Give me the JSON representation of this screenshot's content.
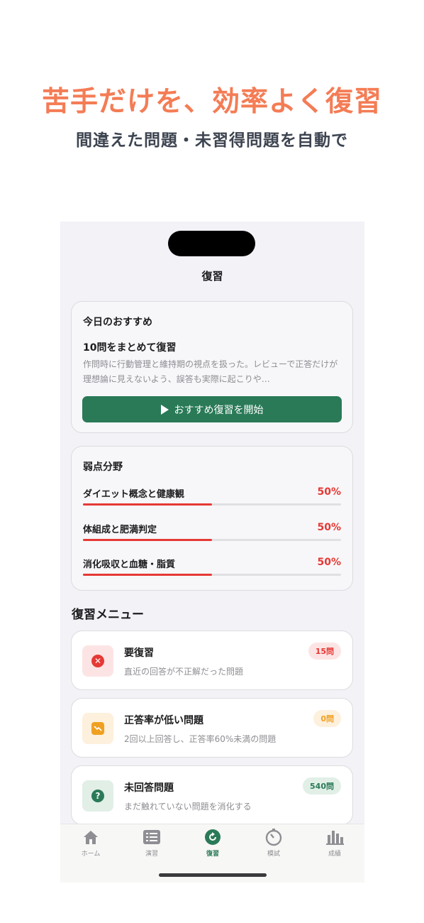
{
  "promo": {
    "headline": "苦手だけを、効率よく復習",
    "subheadline": "間違えた問題・未習得問題を自動で"
  },
  "nav": {
    "title": "復習"
  },
  "recommend": {
    "heading": "今日のおすすめ",
    "title": "10問をまとめて復習",
    "description": "作問時に行動管理と維持期の視点を扱った。レビューで正答だけが理想論に見えないよう、誤答も実際に起こりや…",
    "button_label": "おすすめ復習を開始"
  },
  "weak": {
    "heading": "弱点分野",
    "items": [
      {
        "label": "ダイエット概念と健康観",
        "percent_label": "50%",
        "rate": 0.5
      },
      {
        "label": "体組成と肥満判定",
        "percent_label": "50%",
        "rate": 0.5
      },
      {
        "label": "消化吸収と血糖・脂質",
        "percent_label": "50%",
        "rate": 0.5
      }
    ]
  },
  "menu": {
    "heading": "復習メニュー",
    "items": [
      {
        "title": "要復習",
        "subtitle": "直近の回答が不正解だった問題",
        "badge": "15問",
        "icon": "x-circle-icon",
        "icon_bg": "#fde4e4",
        "icon_color": "#e53935",
        "badge_bg": "#fde4e4",
        "badge_color": "#e53935"
      },
      {
        "title": "正答率が低い問題",
        "subtitle": "2回以上回答し、正答率60%未満の問題",
        "badge": "0問",
        "icon": "trend-down-icon",
        "icon_bg": "#fdf0dc",
        "icon_color": "#f0a020",
        "badge_bg": "#fdf0dc",
        "badge_color": "#f0a020"
      },
      {
        "title": "未回答問題",
        "subtitle": "まだ触れていない問題を消化する",
        "badge": "540問",
        "icon": "question-circle-icon",
        "icon_bg": "#e1efe7",
        "icon_color": "#2a7a57",
        "badge_bg": "#e1efe7",
        "badge_color": "#2a7a57"
      }
    ]
  },
  "tabs": [
    {
      "label": "ホーム",
      "icon": "home-icon"
    },
    {
      "label": "演習",
      "icon": "list-icon"
    },
    {
      "label": "復習",
      "icon": "review-icon",
      "active": true
    },
    {
      "label": "模試",
      "icon": "timer-icon"
    },
    {
      "label": "成績",
      "icon": "chart-icon"
    }
  ],
  "colors": {
    "accent": "#2a7a57",
    "headline": "#f47c55",
    "danger": "#e53935"
  }
}
